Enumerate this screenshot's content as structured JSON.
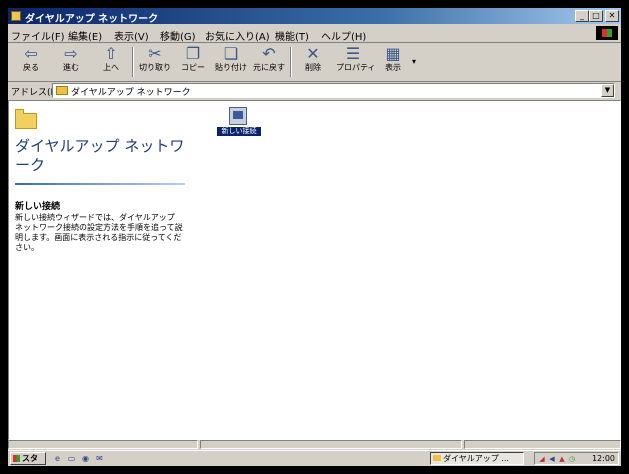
{
  "window": {
    "title": "ダイヤルアップ ネットワーク"
  },
  "menu": [
    "ファイル(F)",
    "編集(E)",
    "表示(V)",
    "移動(G)",
    "お気に入り(A)",
    "機能(T)",
    "ヘルプ(H)"
  ],
  "toolbar": [
    {
      "icon": "back-icon",
      "glyph": "⇦",
      "label": "戻る"
    },
    {
      "icon": "forward-icon",
      "glyph": "⇨",
      "label": "進む"
    },
    {
      "icon": "up-icon",
      "glyph": "⇧",
      "label": "上へ"
    },
    {
      "icon": "cut-icon",
      "glyph": "✂",
      "label": "切り取り"
    },
    {
      "icon": "copy-icon",
      "glyph": "❐",
      "label": "コピー"
    },
    {
      "icon": "paste-icon",
      "glyph": "❏",
      "label": "貼り付け"
    },
    {
      "icon": "undo-icon",
      "glyph": "↶",
      "label": "元に戻す"
    },
    {
      "icon": "delete-icon",
      "glyph": "✕",
      "label": "削除"
    },
    {
      "icon": "properties-icon",
      "glyph": "☰",
      "label": "プロパティ"
    },
    {
      "icon": "views-icon",
      "glyph": "▦",
      "label": "表示"
    }
  ],
  "address": {
    "label": "アドレス(D)",
    "value": "ダイヤルアップ ネットワーク"
  },
  "panel": {
    "title": "ダイヤルアップ ネットワーク",
    "heading": "新しい接続",
    "description": "新しい接続ウィザードでは、ダイヤルアップ ネットワーク接続の設定方法を手順を追って説明します。画面に表示される指示に従ってください。"
  },
  "file_icon": {
    "name": "新しい接続"
  },
  "taskbar": {
    "start_label": "スタート",
    "task_label": "ダイヤルアップ ...",
    "clock": "12:00"
  },
  "colors": {
    "titlebar_start": "#0a246a",
    "titlebar_end": "#a6caf0",
    "face": "#d4d0c8",
    "panel_title": "#1d3f7a"
  }
}
